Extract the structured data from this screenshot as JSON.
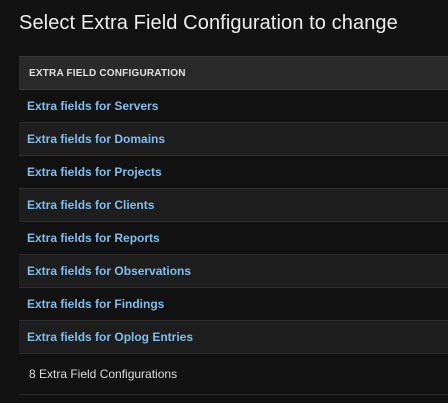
{
  "page": {
    "title": "Select Extra Field Configuration to change"
  },
  "table": {
    "column_header": "EXTRA FIELD CONFIGURATION",
    "rows": [
      "Extra fields for Servers",
      "Extra fields for Domains",
      "Extra fields for Projects",
      "Extra fields for Clients",
      "Extra fields for Reports",
      "Extra fields for Observations",
      "Extra fields for Findings",
      "Extra fields for Oplog Entries"
    ]
  },
  "paginator": {
    "text": "8 Extra Field Configurations"
  },
  "colors": {
    "background": "#121212",
    "link": "#7ebfee",
    "header_bg": "#2a2a2a",
    "row_alt_bg": "#1e1e1e"
  }
}
